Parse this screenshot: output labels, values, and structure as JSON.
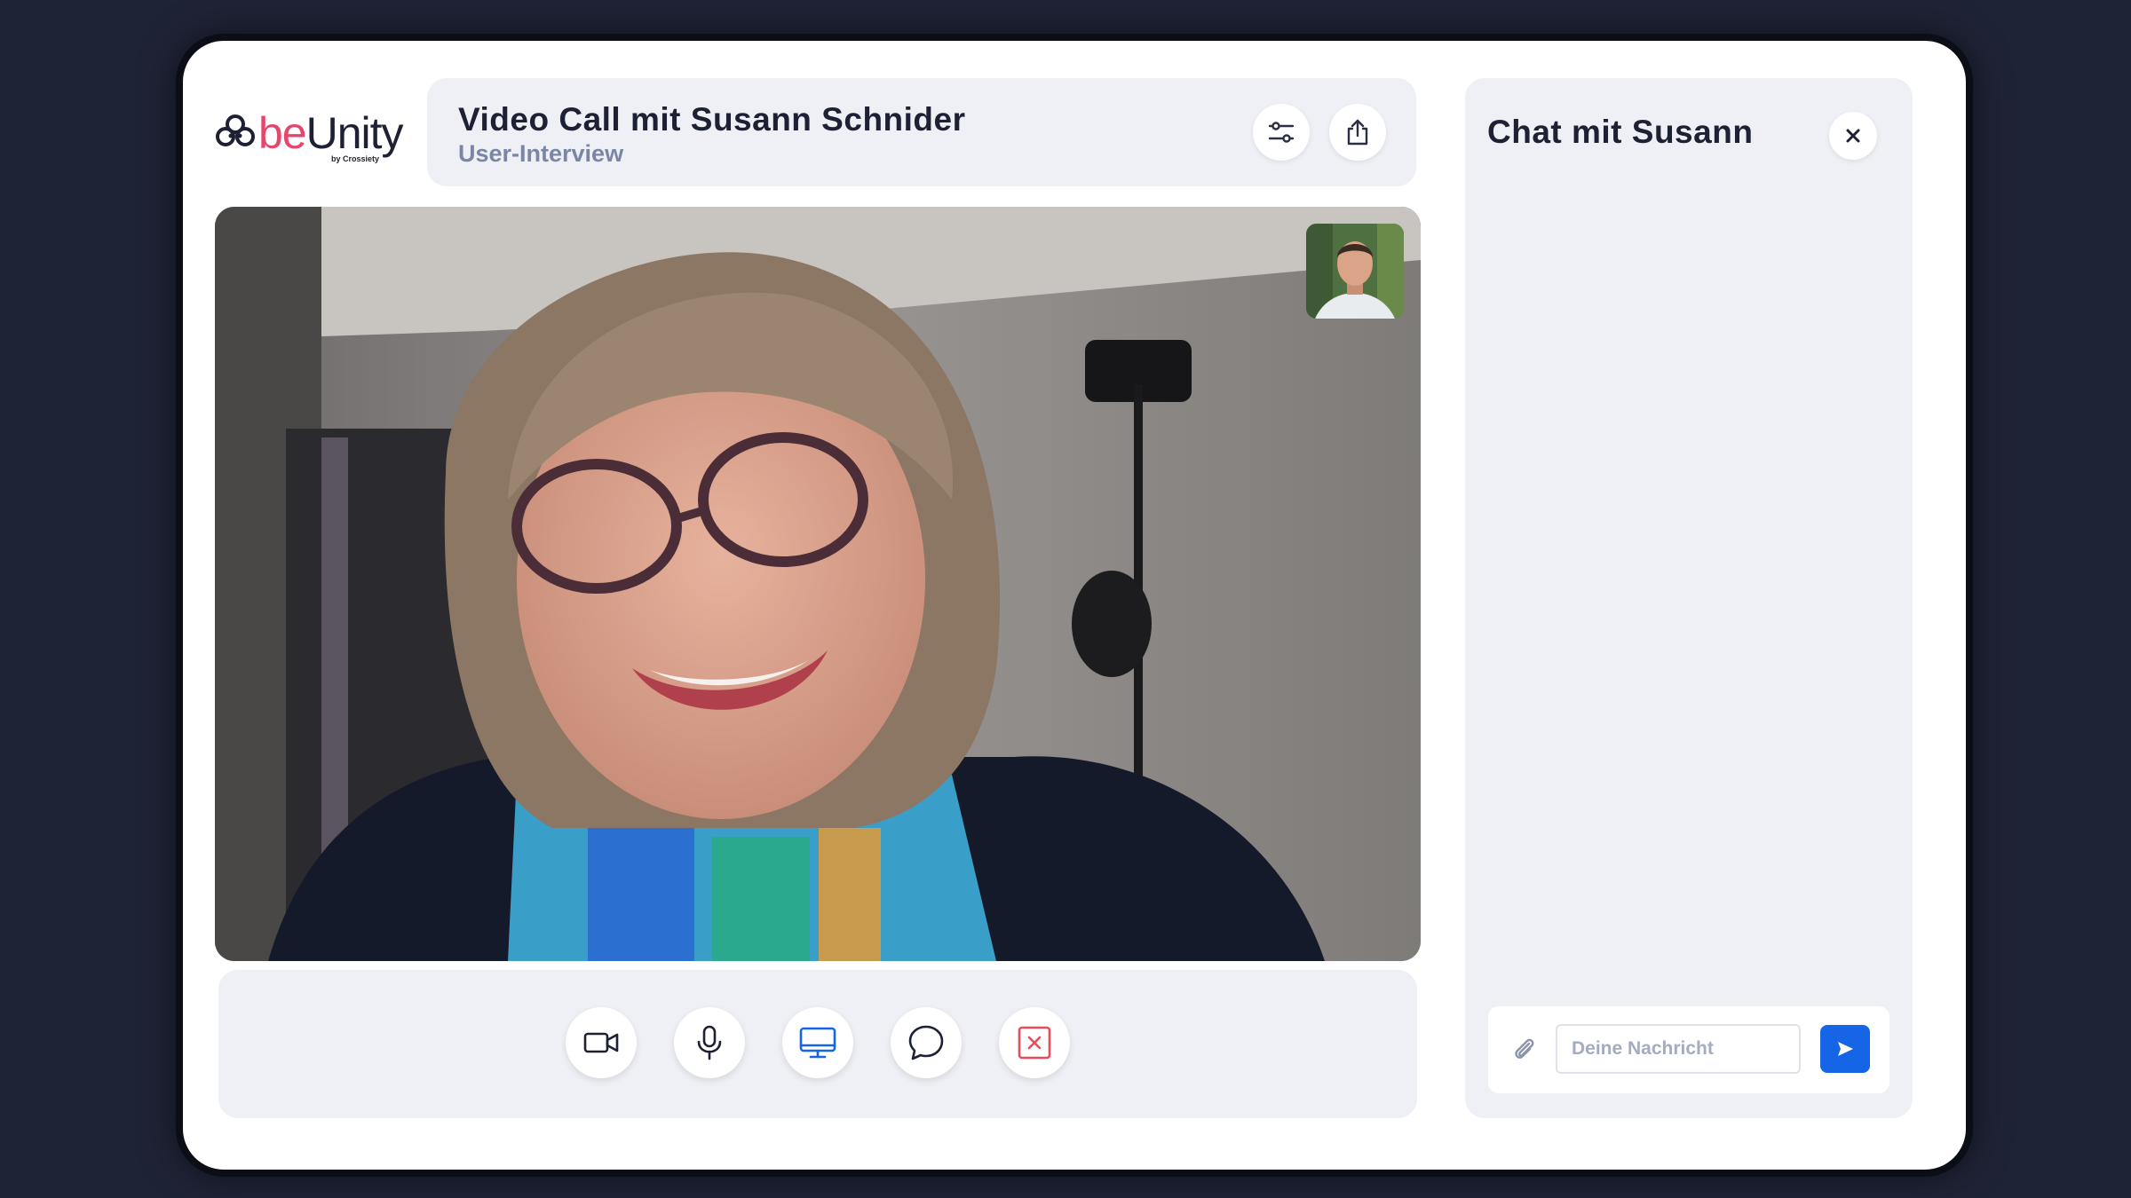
{
  "app": {
    "logo_text_be": "be",
    "logo_text_unity": "Unity",
    "logo_by": "by Crossiety"
  },
  "header": {
    "title": "Video Call mit Susann Schnider",
    "subtitle": "User-Interview",
    "icons": [
      "settings-sliders-icon",
      "share-icon"
    ]
  },
  "call": {
    "controls": [
      {
        "name": "camera-icon",
        "active": false
      },
      {
        "name": "microphone-icon",
        "active": false
      },
      {
        "name": "screen-share-icon",
        "active": true
      },
      {
        "name": "chat-bubble-icon",
        "active": false
      },
      {
        "name": "end-call-icon",
        "active": false
      }
    ]
  },
  "chat": {
    "title": "Chat mit Susann",
    "input_placeholder": "Deine Nachricht",
    "input_value": ""
  },
  "colors": {
    "brand_pink": "#e5466b",
    "accent_blue": "#1565e6",
    "danger_red": "#e94b5b",
    "panel_bg": "#eef0f5",
    "page_bg": "#1f2336"
  }
}
